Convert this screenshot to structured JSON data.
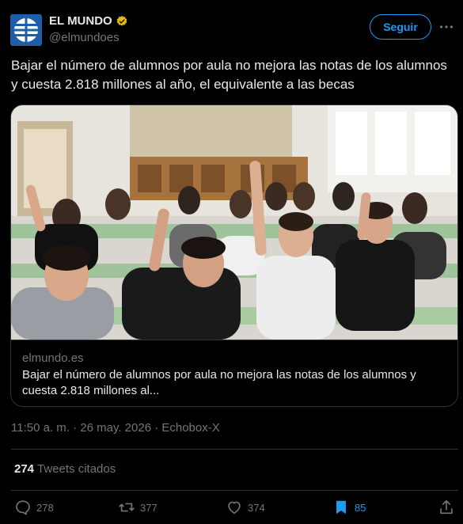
{
  "author": {
    "name": "EL MUNDO",
    "handle": "@elmundoes",
    "verified": true,
    "avatar_color": "#1d5fa8"
  },
  "follow_label": "Seguir",
  "tweet": {
    "text": "Bajar el número de alumnos por aula no mejora las notas de los alumnos y cuesta 2.818 millones al año, el equivalente a las becas"
  },
  "card": {
    "image_alt": "students raising hands in a classroom",
    "domain": "elmundo.es",
    "title": "Bajar el número de alumnos por aula no mejora las notas de los alumnos y cuesta 2.818 millones al..."
  },
  "meta": "11:50 a. m. · 26 may. 2026 · Echobox-X",
  "quotes": {
    "count": "274",
    "label": "Tweets citados"
  },
  "actions": {
    "replies": "278",
    "retweets": "377",
    "likes": "374",
    "bookmarks": "85"
  },
  "colors": {
    "accent": "#1d9bf0",
    "muted": "#71767b",
    "verified_gold": "#e2b719"
  }
}
